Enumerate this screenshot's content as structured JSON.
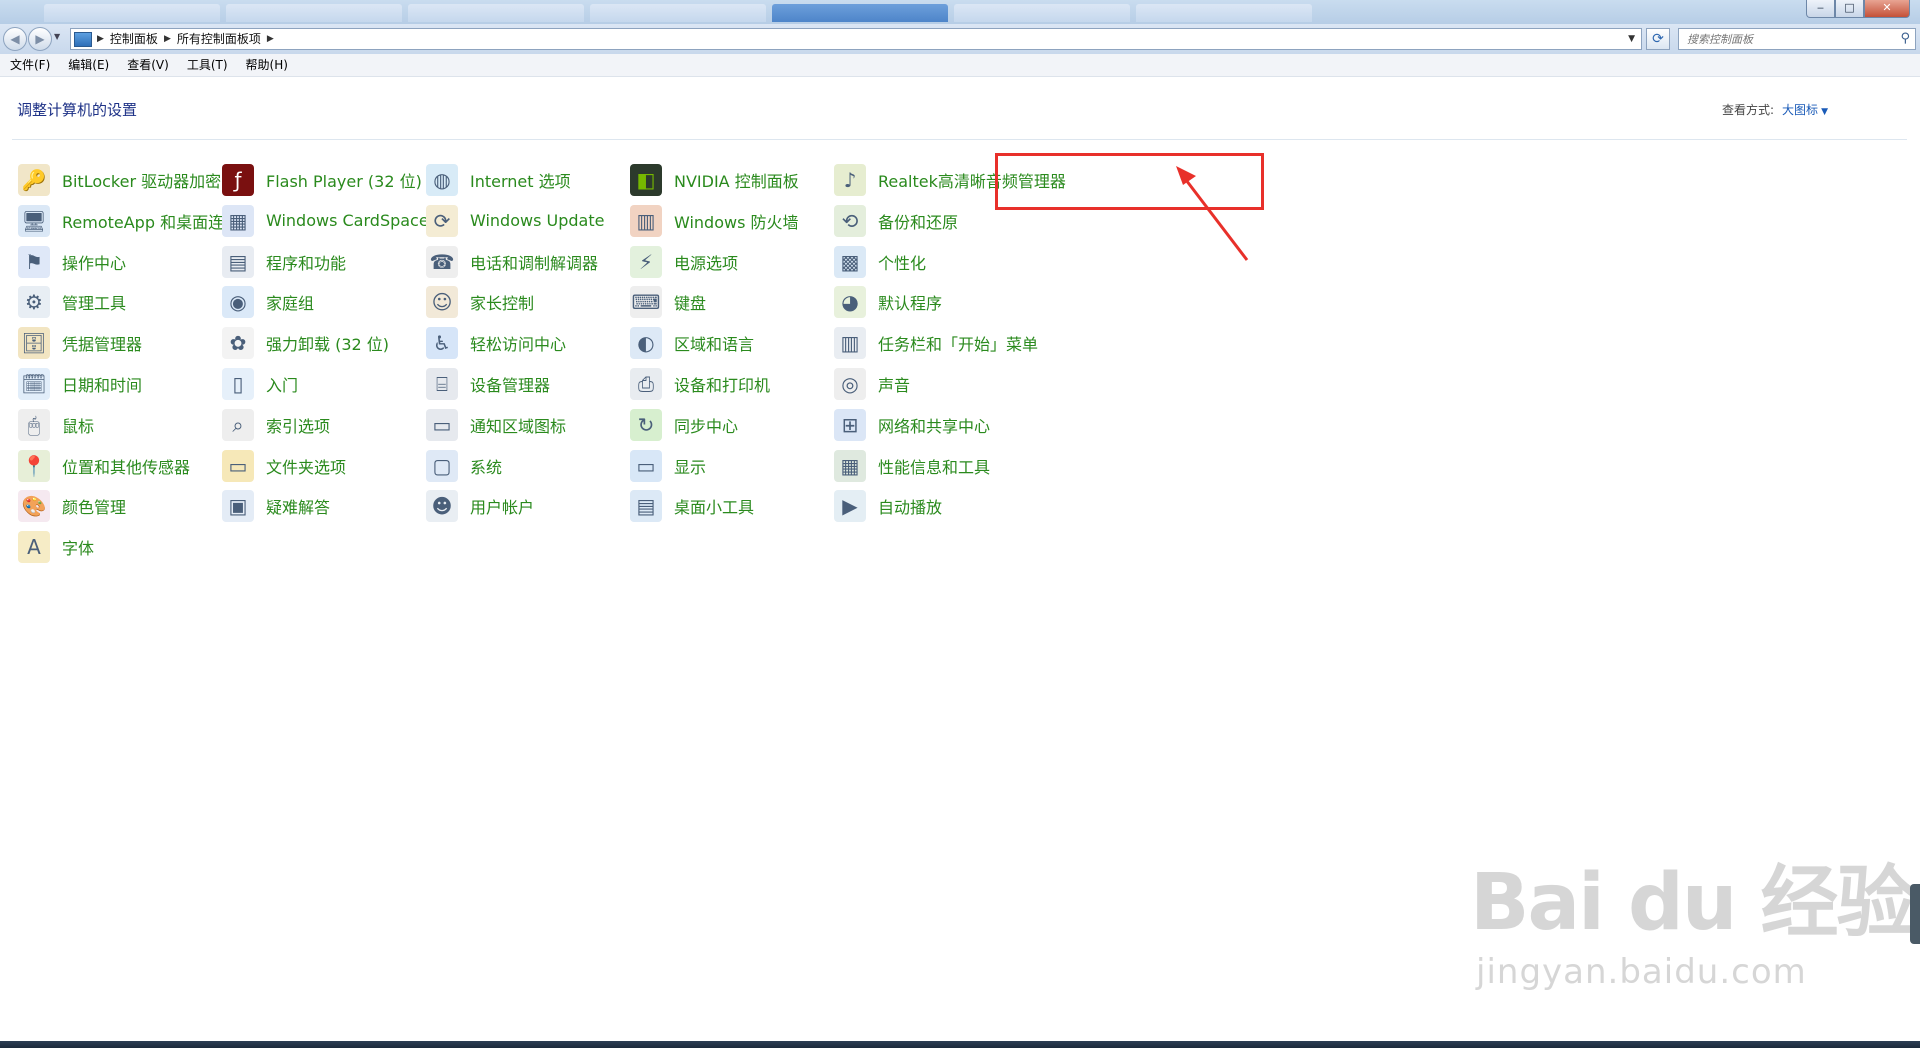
{
  "window": {
    "minimize": "‒",
    "maximize": "□",
    "close": "✕"
  },
  "address": {
    "crumbs": [
      "控制面板",
      "所有控制面板项"
    ],
    "search_placeholder": "搜索控制面板"
  },
  "menu": [
    "文件(F)",
    "编辑(E)",
    "查看(V)",
    "工具(T)",
    "帮助(H)"
  ],
  "content": {
    "heading": "调整计算机的设置",
    "view_label": "查看方式:",
    "view_value": "大图标"
  },
  "items": [
    [
      "BitLocker 驱动器加密",
      "RemoteApp 和桌面连接",
      "操作中心",
      "管理工具",
      "凭据管理器",
      "日期和时间",
      "鼠标",
      "位置和其他传感器",
      "颜色管理",
      "字体"
    ],
    [
      "Flash Player (32 位)",
      "Windows CardSpace",
      "程序和功能",
      "家庭组",
      "强力卸载 (32 位)",
      "入门",
      "索引选项",
      "文件夹选项",
      "疑难解答"
    ],
    [
      "Internet 选项",
      "Windows Update",
      "电话和调制解调器",
      "家长控制",
      "轻松访问中心",
      "设备管理器",
      "通知区域图标",
      "系统",
      "用户帐户"
    ],
    [
      "NVIDIA 控制面板",
      "Windows 防火墙",
      "电源选项",
      "键盘",
      "区域和语言",
      "设备和打印机",
      "同步中心",
      "显示",
      "桌面小工具"
    ],
    [
      "Realtek高清晰音频管理器",
      "备份和还原",
      "个性化",
      "默认程序",
      "任务栏和「开始」菜单",
      "声音",
      "网络和共享中心",
      "性能信息和工具",
      "自动播放"
    ]
  ],
  "icons": [
    [
      "bitlocker-icon",
      "remoteapp-icon",
      "action-center-icon",
      "admin-tools-icon",
      "credential-icon",
      "datetime-icon",
      "mouse-icon",
      "sensor-icon",
      "color-mgmt-icon",
      "fonts-icon"
    ],
    [
      "flash-icon",
      "cardspace-icon",
      "programs-icon",
      "homegroup-icon",
      "uninstaller-icon",
      "getting-started-icon",
      "indexing-icon",
      "folder-options-icon",
      "troubleshoot-icon"
    ],
    [
      "internet-options-icon",
      "windows-update-icon",
      "phone-modem-icon",
      "parental-control-icon",
      "ease-of-access-icon",
      "device-manager-icon",
      "notification-icons-icon",
      "system-icon",
      "user-accounts-icon"
    ],
    [
      "nvidia-icon",
      "firewall-icon",
      "power-icon",
      "keyboard-icon",
      "region-language-icon",
      "devices-printers-icon",
      "sync-center-icon",
      "display-icon",
      "gadgets-icon"
    ],
    [
      "realtek-audio-icon",
      "backup-restore-icon",
      "personalize-icon",
      "default-programs-icon",
      "taskbar-start-icon",
      "sound-icon",
      "network-sharing-icon",
      "performance-icon",
      "autoplay-icon"
    ]
  ],
  "watermark": {
    "logo": "Bai du 经验",
    "url": "jingyan.baidu.com"
  },
  "colors": {
    "item_text": "#2a8a1d",
    "heading": "#1e3287",
    "highlight": "#e8302a"
  }
}
